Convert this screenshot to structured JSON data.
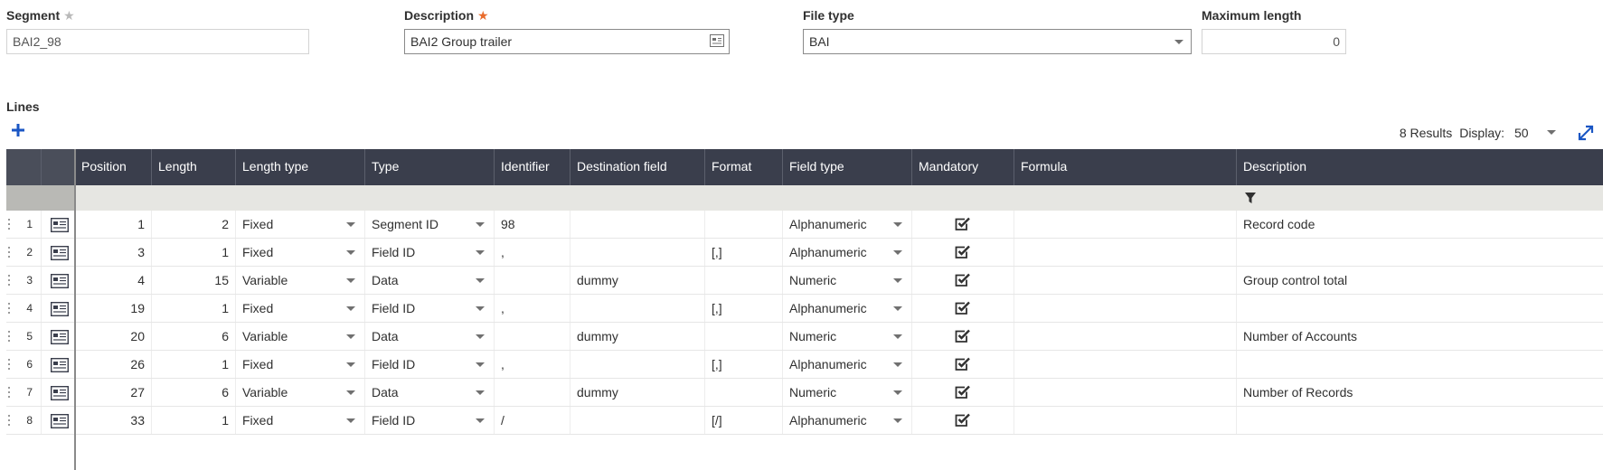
{
  "form": {
    "segment": {
      "label": "Segment",
      "value": "BAI2_98"
    },
    "description": {
      "label": "Description",
      "value": "BAI2 Group trailer"
    },
    "file_type": {
      "label": "File type",
      "value": "BAI"
    },
    "max_length": {
      "label": "Maximum length",
      "value": "0"
    },
    "required_star": "★"
  },
  "lines": {
    "title": "Lines",
    "add_icon": "plus-icon",
    "results": "8 Results",
    "display_label": "Display:",
    "display_value": "50",
    "expand_icon": "expand-icon",
    "filter_icon": "filter-icon",
    "columns": [
      "Position",
      "Length",
      "Length type",
      "Type",
      "Identifier",
      "Destination field",
      "Format",
      "Field type",
      "Mandatory",
      "Formula",
      "Description"
    ],
    "rows": [
      {
        "n": "1",
        "position": "1",
        "length": "2",
        "length_type": "Fixed",
        "type": "Segment ID",
        "identifier": "98",
        "destination": "",
        "format": "",
        "field_type": "Alphanumeric",
        "mandatory": true,
        "formula": "",
        "description": "Record code"
      },
      {
        "n": "2",
        "position": "3",
        "length": "1",
        "length_type": "Fixed",
        "type": "Field ID",
        "identifier": ",",
        "destination": "",
        "format": "[,]",
        "field_type": "Alphanumeric",
        "mandatory": true,
        "formula": "",
        "description": ""
      },
      {
        "n": "3",
        "position": "4",
        "length": "15",
        "length_type": "Variable",
        "type": "Data",
        "identifier": "",
        "destination": "dummy",
        "format": "",
        "field_type": "Numeric",
        "mandatory": true,
        "formula": "",
        "description": "Group control total"
      },
      {
        "n": "4",
        "position": "19",
        "length": "1",
        "length_type": "Fixed",
        "type": "Field ID",
        "identifier": ",",
        "destination": "",
        "format": "[,]",
        "field_type": "Alphanumeric",
        "mandatory": true,
        "formula": "",
        "description": ""
      },
      {
        "n": "5",
        "position": "20",
        "length": "6",
        "length_type": "Variable",
        "type": "Data",
        "identifier": "",
        "destination": "dummy",
        "format": "",
        "field_type": "Numeric",
        "mandatory": true,
        "formula": "",
        "description": "Number of Accounts"
      },
      {
        "n": "6",
        "position": "26",
        "length": "1",
        "length_type": "Fixed",
        "type": "Field ID",
        "identifier": ",",
        "destination": "",
        "format": "[,]",
        "field_type": "Alphanumeric",
        "mandatory": true,
        "formula": "",
        "description": ""
      },
      {
        "n": "7",
        "position": "27",
        "length": "6",
        "length_type": "Variable",
        "type": "Data",
        "identifier": "",
        "destination": "dummy",
        "format": "",
        "field_type": "Numeric",
        "mandatory": true,
        "formula": "",
        "description": "Number of Records"
      },
      {
        "n": "8",
        "position": "33",
        "length": "1",
        "length_type": "Fixed",
        "type": "Field ID",
        "identifier": "/",
        "destination": "",
        "format": "[/]",
        "field_type": "Alphanumeric",
        "mandatory": true,
        "formula": "",
        "description": ""
      }
    ]
  },
  "colors": {
    "header_bg": "#3a3e4c",
    "accent": "#1a56c4",
    "required": "#e96b2b"
  }
}
